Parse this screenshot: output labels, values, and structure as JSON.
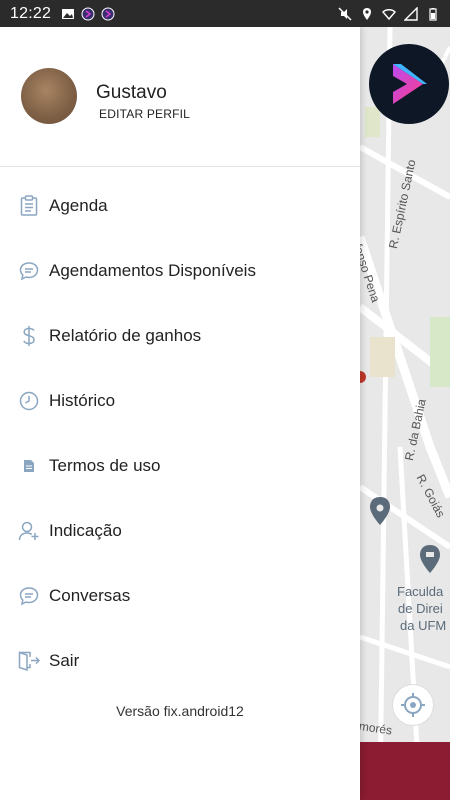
{
  "status_bar": {
    "time": "12:22",
    "left_icons": [
      "gallery-icon",
      "app-notification-icon",
      "app-notification-icon"
    ],
    "right_icons": [
      "mute-icon",
      "location-icon",
      "wifi-icon",
      "signal-icon",
      "battery-icon"
    ]
  },
  "profile": {
    "name": "Gustavo",
    "edit_label": "EDITAR PERFIL"
  },
  "menu": {
    "items": [
      {
        "label": "Agenda",
        "icon": "clipboard-icon"
      },
      {
        "label": "Agendamentos Disponíveis",
        "icon": "chat-bubble-icon"
      },
      {
        "label": "Relatório de ganhos",
        "icon": "dollar-icon"
      },
      {
        "label": "Histórico",
        "icon": "clock-icon"
      },
      {
        "label": "Termos de uso",
        "icon": "document-icon"
      },
      {
        "label": "Indicação",
        "icon": "add-user-icon"
      },
      {
        "label": "Conversas",
        "icon": "chat-bubble-icon"
      },
      {
        "label": "Sair",
        "icon": "logout-icon"
      }
    ]
  },
  "version": "Versão fix.android12",
  "map": {
    "labels": [
      "R. Espírito Santo",
      "fonso Pena",
      "R. da Bahia",
      "R. Goiás",
      "Faculda",
      "de Direi",
      "da UFM",
      "morés"
    ]
  },
  "colors": {
    "icon_accent": "#8aa6c1",
    "brand_bar": "#8b1c31",
    "logo_bg": "#0d1726"
  }
}
